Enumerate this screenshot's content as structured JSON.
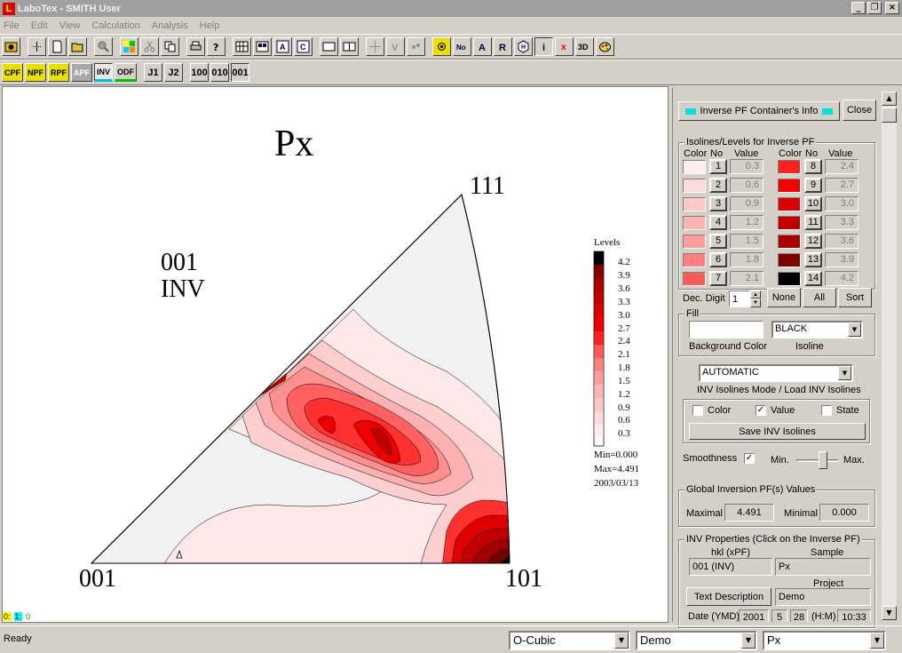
{
  "window": {
    "title": "LaboTex - SMITH User",
    "app_icon_letter": "L"
  },
  "menu": [
    "File",
    "Edit",
    "View",
    "Calculation",
    "Analysis",
    "Help"
  ],
  "toolbar2": {
    "pf_buttons": [
      "CPF",
      "NPF",
      "RPF",
      "APF",
      "INV",
      "ODF"
    ],
    "j_buttons": [
      "J1",
      "J2"
    ],
    "dir_buttons": [
      "100",
      "010",
      "001"
    ]
  },
  "plot": {
    "title": "Px",
    "subtitle_line1": "001",
    "subtitle_line2": "INV",
    "corner_111": "111",
    "corner_001": "001",
    "corner_101": "101",
    "legend_title": "Levels",
    "legend_levels": [
      "4.2",
      "3.9",
      "3.6",
      "3.3",
      "3.0",
      "2.7",
      "2.4",
      "2.1",
      "1.8",
      "1.5",
      "1.2",
      "0.9",
      "0.6",
      "0.3"
    ],
    "min_text": "Min=0.000",
    "max_text": "Max=4.491",
    "date_text": "2003/03/13"
  },
  "status_codes": [
    "0:",
    "1:",
    "0"
  ],
  "panel": {
    "container_info_label": "Inverse PF Container's Info",
    "close_label": "Close",
    "isolines_title": "Isolines/Levels for Inverse PF",
    "col_color": "Color",
    "col_no": "No",
    "col_value": "Value",
    "levels_left": [
      {
        "no": "1",
        "value": "0.3",
        "color": "#ffecec"
      },
      {
        "no": "2",
        "value": "0.6",
        "color": "#ffdada"
      },
      {
        "no": "3",
        "value": "0.9",
        "color": "#ffc8c8"
      },
      {
        "no": "4",
        "value": "1.2",
        "color": "#ffb4b4"
      },
      {
        "no": "5",
        "value": "1.5",
        "color": "#ff9c9c"
      },
      {
        "no": "6",
        "value": "1.8",
        "color": "#ff8080"
      },
      {
        "no": "7",
        "value": "2.1",
        "color": "#ff5a5a"
      }
    ],
    "levels_right": [
      {
        "no": "8",
        "value": "2.4",
        "color": "#ff2020"
      },
      {
        "no": "9",
        "value": "2.7",
        "color": "#f00000"
      },
      {
        "no": "10",
        "value": "3.0",
        "color": "#d80000"
      },
      {
        "no": "11",
        "value": "3.3",
        "color": "#c00000"
      },
      {
        "no": "12",
        "value": "3.6",
        "color": "#a80000"
      },
      {
        "no": "13",
        "value": "3.9",
        "color": "#800000"
      },
      {
        "no": "14",
        "value": "4.2",
        "color": "#000000"
      }
    ],
    "dec_digit_label": "Dec. Digit",
    "dec_digit_value": "1",
    "none_label": "None",
    "all_label": "All",
    "sort_label": "Sort",
    "fill_title": "Fill",
    "isoline_color_value": "BLACK",
    "background_color_label": "Background Color",
    "isoline_label": "Isoline",
    "mode_value": "AUTOMATIC",
    "mode_label": "INV Isolines Mode / Load INV Isolines",
    "check_color_label": "Color",
    "check_value_label": "Value",
    "check_state_label": "State",
    "check_color": false,
    "check_value": true,
    "check_state": false,
    "save_label": "Save INV Isolines",
    "smoothness_label": "Smoothness",
    "smoothness_checked": true,
    "min_label": "Min.",
    "max_label": "Max.",
    "global_title": "Global Inversion PF(s) Values",
    "maximal_label": "Maximal",
    "maximal_value": "4.491",
    "minimal_label": "Minimal",
    "minimal_value": "0.000",
    "inv_props_title": "INV Properties  (Click on the Inverse PF)",
    "hkl_label": "hkl  (xPF)",
    "sample_label": "Sample",
    "hkl_value": "001     (INV)",
    "sample_value": "Px",
    "project_label": "Project",
    "text_desc_label": "Text  Description",
    "project_value": "Demo",
    "date_label": "Date (YMD)",
    "date_y": "2001",
    "date_m": "5",
    "date_d": "28",
    "time_label": "(H:M)",
    "time_value": "10:33"
  },
  "statusbar": {
    "ready": "Ready",
    "symmetry": "O-Cubic",
    "project": "Demo",
    "sample": "Px"
  }
}
